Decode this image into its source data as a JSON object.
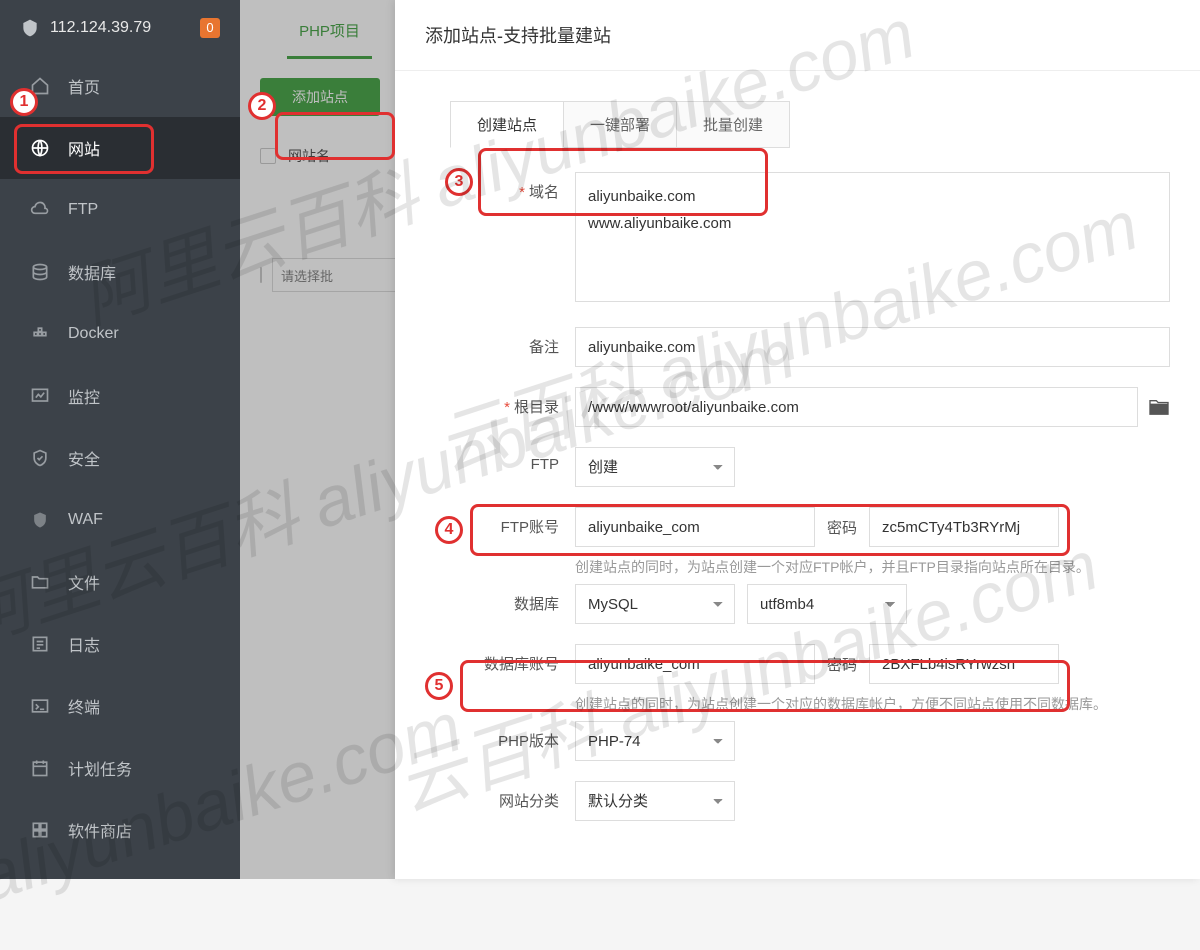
{
  "header": {
    "ip": "112.124.39.79",
    "notif": "0"
  },
  "sidebar": {
    "items": [
      {
        "label": "首页",
        "icon": "home"
      },
      {
        "label": "网站",
        "icon": "globe"
      },
      {
        "label": "FTP",
        "icon": "cloud"
      },
      {
        "label": "数据库",
        "icon": "db"
      },
      {
        "label": "Docker",
        "icon": "docker"
      },
      {
        "label": "监控",
        "icon": "monitor"
      },
      {
        "label": "安全",
        "icon": "shield2"
      },
      {
        "label": "WAF",
        "icon": "waf"
      },
      {
        "label": "文件",
        "icon": "folder"
      },
      {
        "label": "日志",
        "icon": "log"
      },
      {
        "label": "终端",
        "icon": "terminal"
      },
      {
        "label": "计划任务",
        "icon": "calendar"
      },
      {
        "label": "软件商店",
        "icon": "apps"
      }
    ]
  },
  "content": {
    "tab_php": "PHP项目",
    "add_site": "添加站点",
    "col_sitename": "网站名",
    "batch_placeholder": "请选择批"
  },
  "modal": {
    "title": "添加站点-支持批量建站",
    "tabs": {
      "create": "创建站点",
      "deploy": "一键部署",
      "batch": "批量创建"
    },
    "labels": {
      "domain": "域名",
      "remark": "备注",
      "root": "根目录",
      "ftp": "FTP",
      "ftp_account": "FTP账号",
      "password": "密码",
      "database": "数据库",
      "db_account": "数据库账号",
      "php_version": "PHP版本",
      "site_category": "网站分类"
    },
    "values": {
      "domain_text": "aliyunbaike.com\nwww.aliyunbaike.com",
      "remark": "aliyunbaike.com",
      "root": "/www/wwwroot/aliyunbaike.com",
      "ftp_mode": "创建",
      "ftp_user": "aliyunbaike_com",
      "ftp_pwd": "zc5mCTy4Tb3RYrMj",
      "db_type": "MySQL",
      "db_charset": "utf8mb4",
      "db_user": "aliyunbaike_com",
      "db_pwd": "2BXFLb4isRYrwzsn",
      "php_ver": "PHP-74",
      "category": "默认分类"
    },
    "help": {
      "ftp": "创建站点的同时，为站点创建一个对应FTP帐户，并且FTP目录指向站点所在目录。",
      "db": "创建站点的同时，为站点创建一个对应的数据库帐户，方便不同站点使用不同数据库。"
    }
  },
  "annotations": [
    "1",
    "2",
    "3",
    "4",
    "5"
  ],
  "watermarks": [
    "阿里云百科 aliyunbaike.com",
    "阿里云百科 aliyunbaike.com",
    "云百科 aliyunbaike.com",
    "科 aliyunbaike.com"
  ]
}
